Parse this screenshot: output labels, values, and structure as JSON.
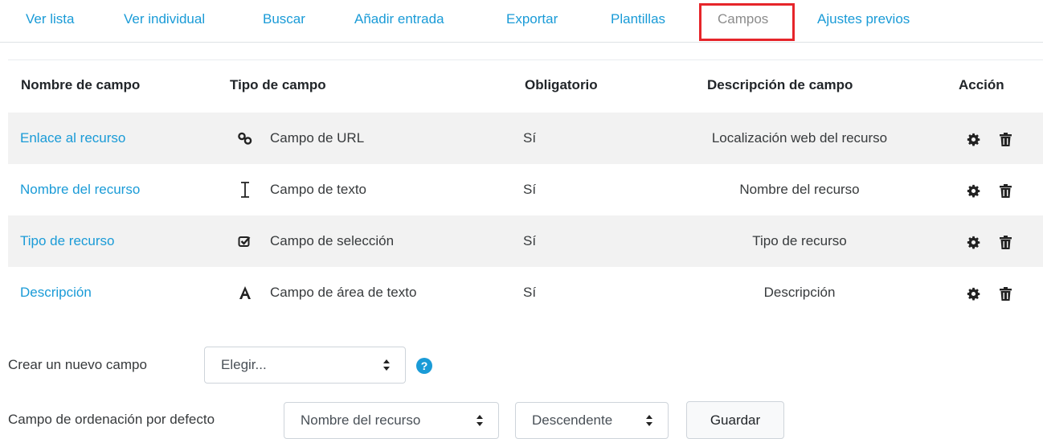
{
  "tabs": [
    {
      "label": "Ver lista"
    },
    {
      "label": "Ver individual"
    },
    {
      "label": "Buscar"
    },
    {
      "label": "Añadir entrada"
    },
    {
      "label": "Exportar"
    },
    {
      "label": "Plantillas"
    },
    {
      "label": "Campos",
      "active": true
    },
    {
      "label": "Ajustes previos"
    }
  ],
  "table": {
    "headers": {
      "name": "Nombre de campo",
      "type": "Tipo de campo",
      "required": "Obligatorio",
      "description": "Descripción de campo",
      "action": "Acción"
    },
    "rows": [
      {
        "name": "Enlace al recurso",
        "type_icon": "link-icon",
        "type": "Campo de URL",
        "required": "Sí",
        "description": "Localización web del recurso"
      },
      {
        "name": "Nombre del recurso",
        "type_icon": "text-cursor-icon",
        "type": "Campo de texto",
        "required": "Sí",
        "description": "Nombre del recurso"
      },
      {
        "name": "Tipo de recurso",
        "type_icon": "checkbox-icon",
        "type": "Campo de selección",
        "required": "Sí",
        "description": "Tipo de recurso"
      },
      {
        "name": "Descripción",
        "type_icon": "letter-a-icon",
        "type": "Campo de área de texto",
        "required": "Sí",
        "description": "Descripción"
      }
    ]
  },
  "new_field": {
    "label": "Crear un nuevo campo",
    "select_value": "Elegir...",
    "help_icon": "question-circle-icon"
  },
  "default_sort": {
    "label": "Campo de ordenación por defecto",
    "field_value": "Nombre del recurso",
    "order_value": "Descendente",
    "save_label": "Guardar"
  },
  "colors": {
    "link": "#1a9bd7",
    "active_tab_border": "#e6252a",
    "stripe": "#f2f2f2"
  }
}
